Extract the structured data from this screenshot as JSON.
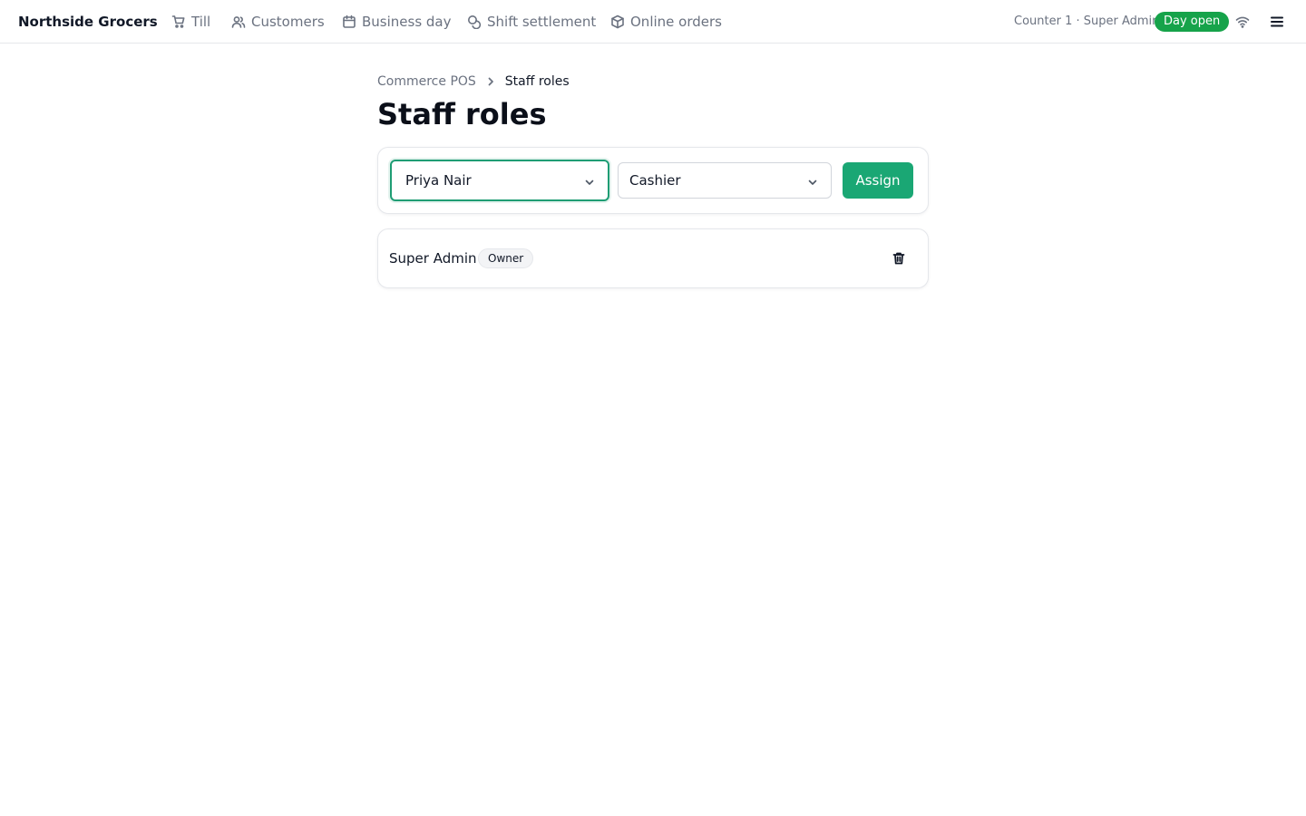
{
  "header": {
    "brand": "Northside Grocers",
    "nav": [
      {
        "label": "Till",
        "icon": "cart-icon"
      },
      {
        "label": "Customers",
        "icon": "users-icon"
      },
      {
        "label": "Business day",
        "icon": "calendar-icon"
      },
      {
        "label": "Shift settlement",
        "icon": "coins-icon"
      },
      {
        "label": "Online orders",
        "icon": "package-icon"
      }
    ],
    "counter": "Counter 1 · Super Admin",
    "day_status": "Day open",
    "icons": {
      "connection": "wifi-icon",
      "menu": "menu-icon"
    }
  },
  "breadcrumb": {
    "parent": "Commerce POS",
    "current": "Staff roles"
  },
  "page": {
    "title": "Staff roles"
  },
  "assign_form": {
    "staff_value": "Priya Nair",
    "role_value": "Cashier",
    "assign_label": "Assign"
  },
  "roles": [
    {
      "name": "Super Admin",
      "badge": "Owner",
      "action_icon": "trash-icon"
    }
  ],
  "colors": {
    "accent": "#1aa774",
    "status_green": "#16a34a",
    "focus_ring": "#1f9d74"
  }
}
